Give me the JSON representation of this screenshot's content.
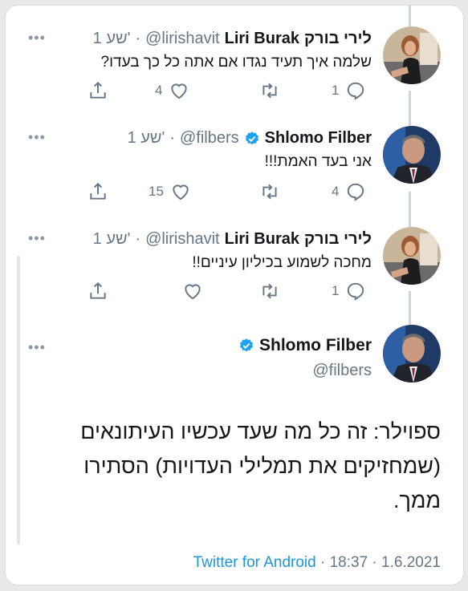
{
  "tweets": [
    {
      "name_he": "לירי בורק",
      "name_en": "Liri Burak",
      "handle": "@lirishavit",
      "time": "1 שע'",
      "text": "שלמה איך תעיד נגדו אם אתה כל כך בעדו?",
      "replies": "1",
      "retweets": "",
      "likes": "4",
      "verified": false
    },
    {
      "name_he": "",
      "name_en": "Shlomo Filber",
      "handle": "@filbers",
      "time": "1 שע'",
      "text": "אני בעד האמת!!!",
      "replies": "4",
      "retweets": "",
      "likes": "15",
      "verified": true
    },
    {
      "name_he": "לירי בורק",
      "name_en": "Liri Burak",
      "handle": "@lirishavit",
      "time": "1 שע'",
      "text": "מחכה לשמוע בכיליון עיניים!!",
      "replies": "1",
      "retweets": "",
      "likes": "",
      "verified": false
    }
  ],
  "separator": "·",
  "more": "•••",
  "main_tweet": {
    "name": "Shlomo Filber",
    "handle": "@filbers",
    "verified": true,
    "line1": "ספוילר: זה כל מה שעד עכשיו העיתונאים",
    "line2": "(שמחזיקים את תמלילי העדויות) הסתירו",
    "line3": "ממך.",
    "time": "18:37",
    "date": "1.6.2021",
    "source": "Twitter for Android"
  },
  "colors": {
    "accent": "#1b95e0",
    "verified": "#1da1f2",
    "secondary_text": "#657786",
    "thread_line": "#d0d5da"
  }
}
